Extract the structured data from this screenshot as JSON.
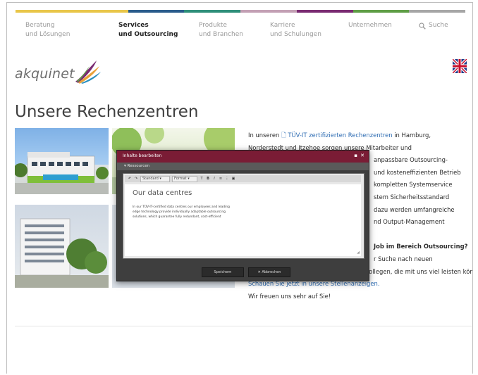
{
  "nav": {
    "items": [
      {
        "line1": "Beratung",
        "line2": "und Lösungen",
        "active": false
      },
      {
        "line1": "Services",
        "line2": "und Outsourcing",
        "active": true
      },
      {
        "line1": "Produkte",
        "line2": "und Branchen",
        "active": false
      },
      {
        "line1": "Karriere",
        "line2": "und Schulungen",
        "active": false
      },
      {
        "line1": "Unternehmen",
        "line2": "",
        "active": false
      }
    ],
    "search_label": "Suche",
    "strip_colors": [
      "#e9c64a",
      "#2a5c8c",
      "#2f8f7a",
      "#c3a0b4",
      "#7a2b72",
      "#5f9e46",
      "#a6a6a6"
    ]
  },
  "brand": {
    "logo_text": "akquinet"
  },
  "page": {
    "title": "Unsere Rechenzentren"
  },
  "article": {
    "p1_a": "In unseren ",
    "p1_link": "TÜV-IT zertifizierten Rechenzentren",
    "p1_b": " in Hamburg,",
    "p2": "Norderstedt und Itzehoe sorgen unsere Mitarbeiter und",
    "p3": "anpassbare Outsourcing-",
    "p4": "und kosteneffizienten Betrieb",
    "p5": "kompletten Systemservice",
    "p6": "stem Sicherheitsstandard",
    "p7": "dazu werden umfangreiche",
    "p8": "nd Output-Management",
    "p9_bold": "Job im Bereich Outsourcing?",
    "p10": "r Suche nach neuen",
    "p11": "Kollegen, die mit uns viel leisten können.",
    "p12_link": "Schauen Sie jetzt in unsere Stellenanzeigen.",
    "p13": "Wir freuen uns sehr auf Sie!"
  },
  "modal": {
    "title": "Inhalte bearbeiten",
    "section_label": "Ressourcen",
    "toolbar": {
      "font_select": "Standard",
      "format_select": "Format"
    },
    "heading": "Our data centres",
    "body_lines": [
      "In our TÜV-IT-certified data centres our employees and leading",
      "edge technology provide individually adaptable outsourcing",
      "solutions, which guarantee fully redundant, cost-efficient"
    ],
    "save_label": "Speichern",
    "cancel_label": "Abbrechen"
  }
}
